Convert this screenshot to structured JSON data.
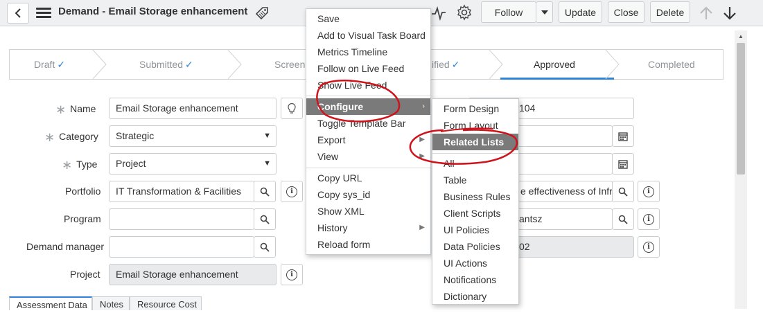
{
  "header": {
    "title": "Demand - Email Storage enhancement",
    "follow_label": "Follow",
    "update_label": "Update",
    "close_label": "Close",
    "delete_label": "Delete"
  },
  "process_flow": {
    "stages": [
      {
        "label": "Draft",
        "state": "completed"
      },
      {
        "label": "Submitted",
        "state": "completed"
      },
      {
        "label": "Screenin",
        "state": "partially-hidden"
      },
      {
        "label": "ified",
        "state": "completed"
      },
      {
        "label": "Approved",
        "state": "current"
      },
      {
        "label": "Completed",
        "state": "pending"
      }
    ],
    "check": "✓"
  },
  "form": {
    "left": [
      {
        "label": "Name",
        "required": true,
        "value": "Email Storage enhancement"
      },
      {
        "label": "Category",
        "required": true,
        "value": "Strategic"
      },
      {
        "label": "Type",
        "required": true,
        "value": "Project"
      },
      {
        "label": "Portfolio",
        "required": false,
        "value": "IT Transformation & Facilities"
      },
      {
        "label": "Program",
        "required": false,
        "value": ""
      },
      {
        "label": "Demand manager",
        "required": false,
        "value": ""
      },
      {
        "label": "Project",
        "required": false,
        "value": "Email Storage enhancement"
      }
    ],
    "right_partial": {
      "number_fragment": "104",
      "description_fragment": "e effectiveness of  Infra",
      "person_fragment": "antsz",
      "code_fragment": "02"
    },
    "required_marker": "∗"
  },
  "tabs": [
    "Assessment Data",
    "Notes",
    "Resource Cost"
  ],
  "context_menu": {
    "items": [
      "Save",
      "Add to Visual Task Board",
      "Metrics Timeline",
      "Follow on Live Feed",
      "Show Live Feed"
    ],
    "configure": "Configure",
    "items2": [
      "Toggle Template Bar",
      "Export",
      "View"
    ],
    "items3": [
      "Copy URL",
      "Copy sys_id",
      "Show XML",
      "History",
      "Reload form"
    ],
    "submenu_arrow": "›",
    "play_arrow": "▶"
  },
  "configure_submenu": {
    "items": [
      "Form Design",
      "Form Layout",
      "Related Lists",
      "All",
      "Table",
      "Business Rules",
      "Client Scripts",
      "UI Policies",
      "Data Policies",
      "UI Actions",
      "Notifications",
      "Dictionary"
    ]
  },
  "colors": {
    "accent": "#2f83d6",
    "menu_highlight": "#7a7a7a",
    "annotation": "#d0121b"
  }
}
